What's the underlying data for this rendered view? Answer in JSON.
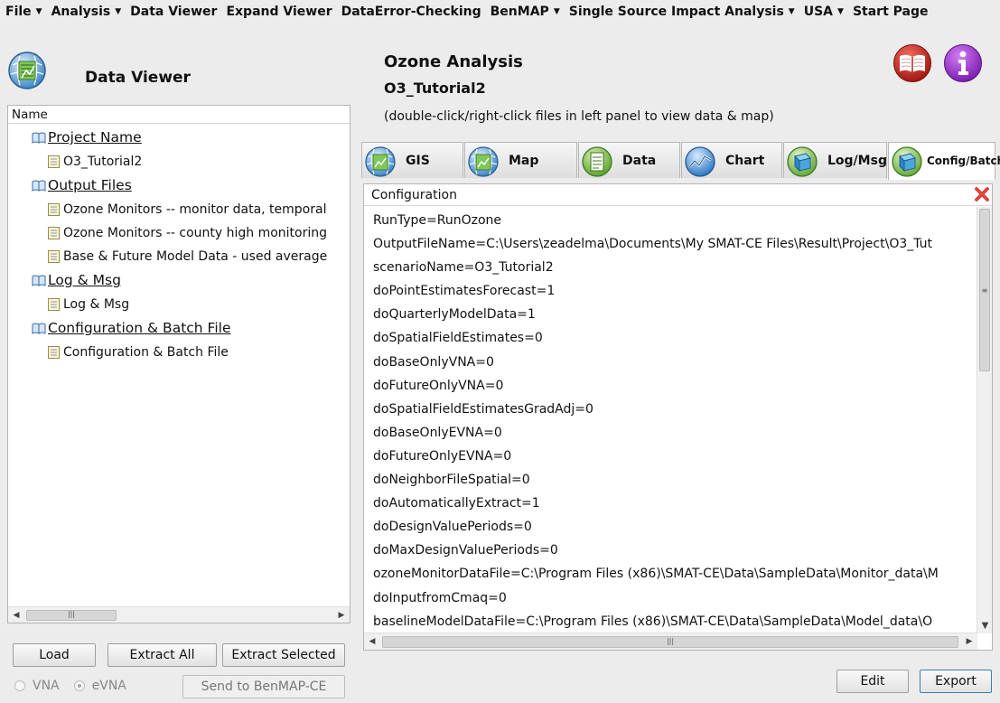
{
  "menu": [
    {
      "label": "File",
      "dropdown": true
    },
    {
      "label": "Analysis",
      "dropdown": true
    },
    {
      "label": "Data Viewer",
      "dropdown": false
    },
    {
      "label": "Expand Viewer",
      "dropdown": false
    },
    {
      "label": "DataError-Checking",
      "dropdown": false
    },
    {
      "label": "BenMAP",
      "dropdown": true
    },
    {
      "label": "Single Source Impact Analysis",
      "dropdown": true
    },
    {
      "label": "USA",
      "dropdown": true
    },
    {
      "label": "Start Page",
      "dropdown": false
    }
  ],
  "left": {
    "title": "Data Viewer",
    "tree_header": "Name",
    "tree": [
      {
        "label": "Project Name",
        "kind": "group"
      },
      {
        "label": "O3_Tutorial2",
        "kind": "leaf"
      },
      {
        "label": "Output Files",
        "kind": "group"
      },
      {
        "label": "Ozone Monitors -- monitor data, temporal",
        "kind": "leaf"
      },
      {
        "label": "Ozone Monitors -- county high monitoring",
        "kind": "leaf"
      },
      {
        "label": "Base & Future Model Data - used average",
        "kind": "leaf"
      },
      {
        "label": "Log & Msg",
        "kind": "group"
      },
      {
        "label": "Log & Msg",
        "kind": "leaf"
      },
      {
        "label": "Configuration & Batch File",
        "kind": "group"
      },
      {
        "label": "Configuration & Batch File",
        "kind": "leaf"
      }
    ],
    "buttons": {
      "load": "Load",
      "extract_all": "Extract All",
      "extract_selected": "Extract Selected",
      "send": "Send to BenMAP-CE"
    },
    "radio": {
      "vna": "VNA",
      "evna": "eVNA",
      "selected": "eVNA"
    }
  },
  "right": {
    "title": "Ozone Analysis",
    "subtitle": "O3_Tutorial2",
    "hint": "(double-click/right-click files in left panel to view data & map)",
    "tabs": [
      {
        "label": "GIS",
        "icon": "globe-icon"
      },
      {
        "label": "Map",
        "icon": "globe-icon"
      },
      {
        "label": "Data",
        "icon": "data-sheet-icon"
      },
      {
        "label": "Chart",
        "icon": "chart-line-icon"
      },
      {
        "label": "Log/Msg",
        "icon": "cube-icon"
      },
      {
        "label": "Config/Batch",
        "icon": "cube-icon",
        "active": true
      }
    ],
    "config_header": "Configuration",
    "config_lines": [
      "RunType=RunOzone",
      "OutputFileName=C:\\Users\\zeadelma\\Documents\\My SMAT-CE Files\\Result\\Project\\O3_Tut",
      "scenarioName=O3_Tutorial2",
      "doPointEstimatesForecast=1",
      "doQuarterlyModelData=1",
      "doSpatialFieldEstimates=0",
      "doBaseOnlyVNA=0",
      "doFutureOnlyVNA=0",
      "doSpatialFieldEstimatesGradAdj=0",
      "doBaseOnlyEVNA=0",
      "doFutureOnlyEVNA=0",
      "doNeighborFileSpatial=0",
      "doAutomaticallyExtract=1",
      "doDesignValuePeriods=0",
      "doMaxDesignValuePeriods=0",
      "ozoneMonitorDataFile=C:\\Program Files (x86)\\SMAT-CE\\Data\\SampleData\\Monitor_data\\M",
      "doInputfromCmaq=0",
      "baselineModelDataFile=C:\\Program Files (x86)\\SMAT-CE\\Data\\SampleData\\Model_data\\O"
    ],
    "buttons": {
      "edit": "Edit",
      "export": "Export"
    },
    "icons": {
      "help": "book-icon",
      "info": "info-icon"
    }
  }
}
